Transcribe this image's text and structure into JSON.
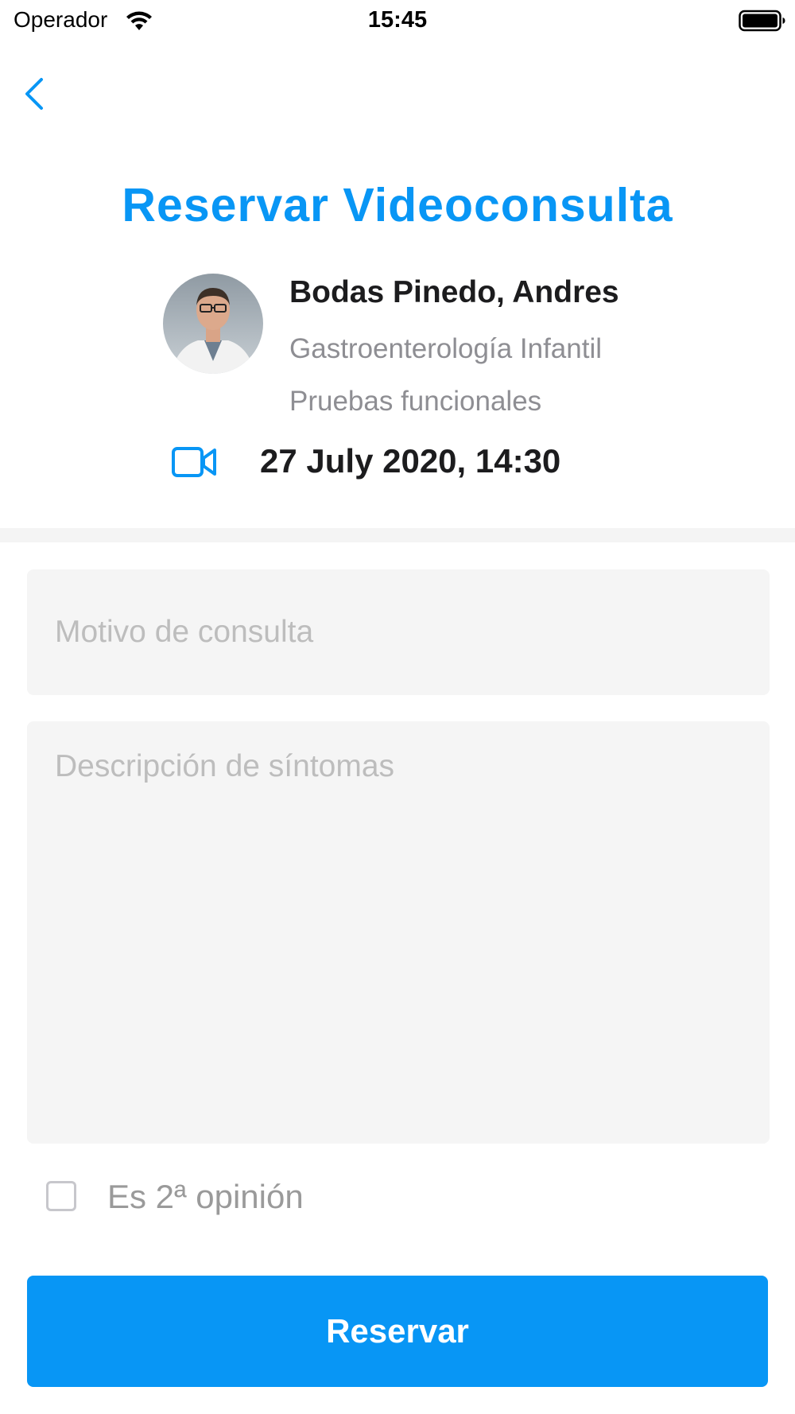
{
  "status_bar": {
    "carrier": "Operador",
    "time": "15:45"
  },
  "header": {
    "back_icon": "chevron-left-icon",
    "title": "Reservar Videoconsulta"
  },
  "doctor": {
    "name": "Bodas Pinedo, Andres",
    "specialty": "Gastroenterología Infantil",
    "subspecialty": "Pruebas funcionales"
  },
  "appointment": {
    "type_icon": "video-camera-icon",
    "datetime": "27 July 2020, 14:30"
  },
  "form": {
    "motivo_placeholder": "Motivo de consulta",
    "motivo_value": "",
    "sintomas_placeholder": "Descripción de síntomas",
    "sintomas_value": "",
    "second_opinion_label": "Es 2ª opinión",
    "second_opinion_checked": false,
    "submit_label": "Reservar"
  },
  "colors": {
    "accent": "#0896f5",
    "field_bg": "#f5f5f5",
    "placeholder": "#bdbdbd",
    "secondary_text": "#8e8e93"
  }
}
